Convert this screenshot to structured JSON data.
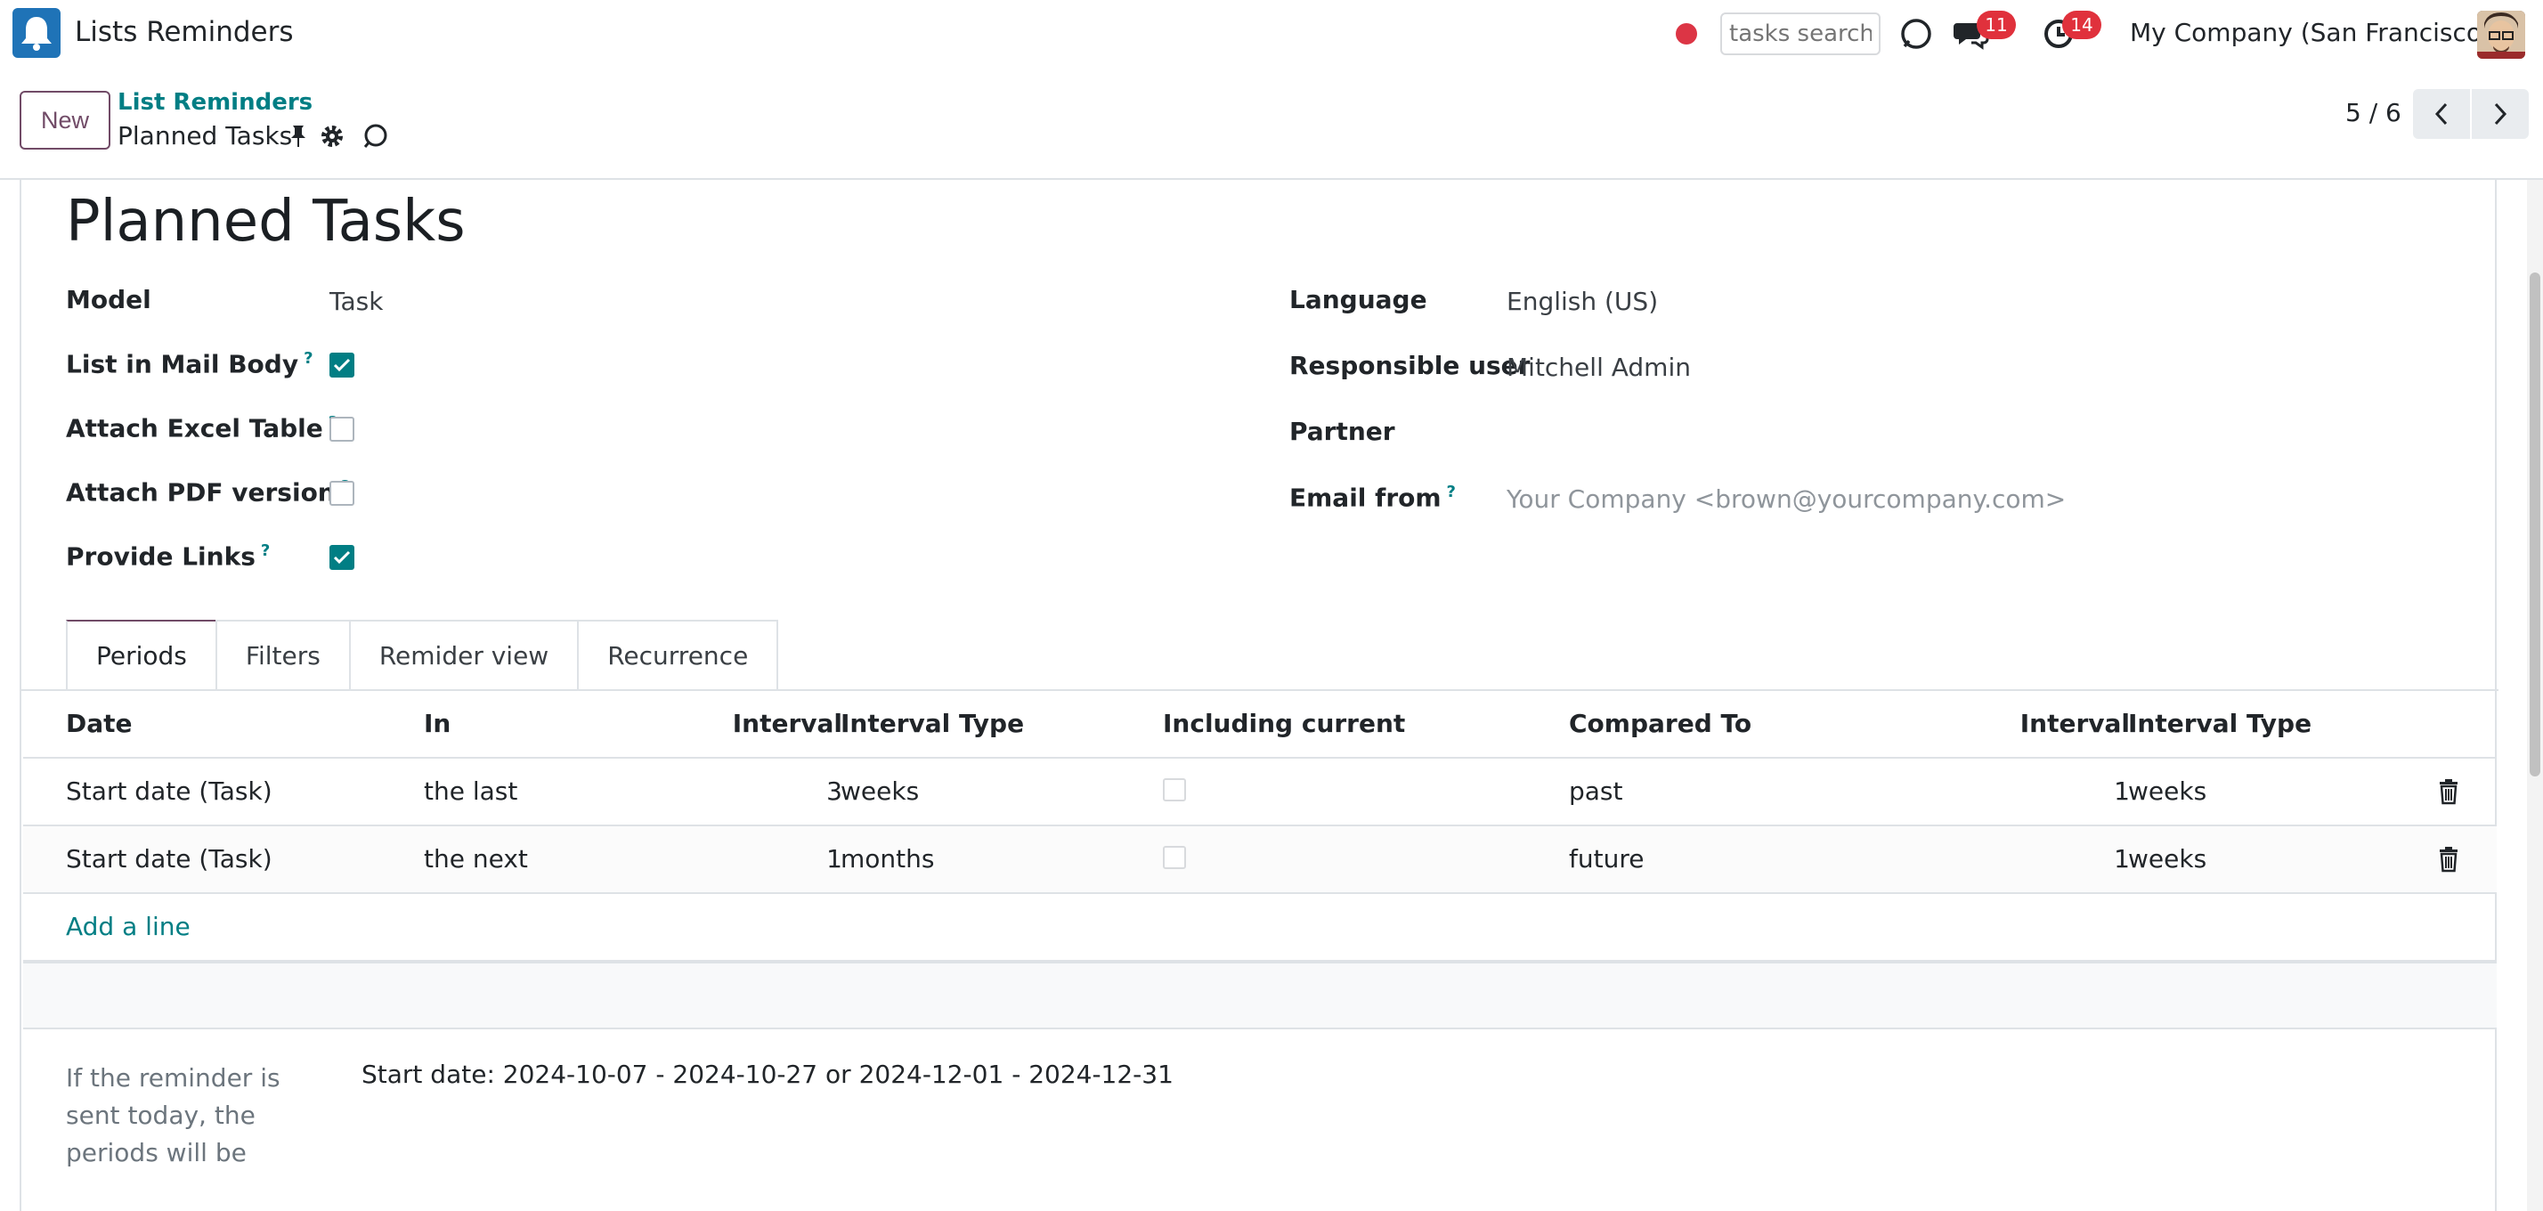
{
  "navbar": {
    "app_name": "Lists Reminders",
    "search_placeholder": "tasks search",
    "messages_count": "11",
    "activities_count": "14",
    "company": "My Company (San Francisco)",
    "icons": {
      "app": "bell-icon",
      "record": "record-dot-icon",
      "discuss": "chat-bubbles-icon",
      "activities": "clock-icon",
      "voip": "phone-bubble-icon"
    }
  },
  "control_panel": {
    "new_label": "New",
    "breadcrumb_parent": "List Reminders",
    "breadcrumb_current": "Planned Tasks",
    "pager": "5 / 6"
  },
  "form": {
    "title": "Planned Tasks",
    "left_fields": [
      {
        "label": "Model",
        "value": "Task"
      },
      {
        "label": "List in Mail Body",
        "help": "?",
        "checked": true
      },
      {
        "label": "Attach Excel Table",
        "help": "?",
        "checked": false
      },
      {
        "label": "Attach PDF version",
        "help": "?",
        "checked": false
      },
      {
        "label": "Provide Links",
        "help": "?",
        "checked": true
      }
    ],
    "right_fields": [
      {
        "label": "Language",
        "value": "English (US)"
      },
      {
        "label": "Responsible user",
        "value": "Mitchell Admin"
      },
      {
        "label": "Partner",
        "value": ""
      },
      {
        "label": "Email from",
        "help": "?",
        "value": "Your Company <brown@yourcompany.com>"
      }
    ]
  },
  "tabs": [
    "Periods",
    "Filters",
    "Remider view",
    "Recurrence"
  ],
  "periods_table": {
    "headers": [
      "Date",
      "In",
      "Interval",
      "Interval Type",
      "Including current",
      "Compared To",
      "Interval",
      "Interval Type"
    ],
    "rows": [
      {
        "date": "Start date (Task)",
        "in": "the last",
        "interval": "3",
        "interval_type": "weeks",
        "including_current": false,
        "compared_to": "past",
        "interval2": "1",
        "interval_type2": "weeks"
      },
      {
        "date": "Start date (Task)",
        "in": "the next",
        "interval": "1",
        "interval_type": "months",
        "including_current": false,
        "compared_to": "future",
        "interval2": "1",
        "interval_type2": "weeks"
      }
    ],
    "add_line": "Add a line"
  },
  "periods_summary": {
    "label": "If the reminder is sent today, the periods will be",
    "value": "Start date: 2024-10-07 - 2024-10-27 or 2024-12-01 - 2024-12-31"
  },
  "colors": {
    "primary": "#714b67",
    "link": "#017e84",
    "badge": "#e0313c"
  }
}
